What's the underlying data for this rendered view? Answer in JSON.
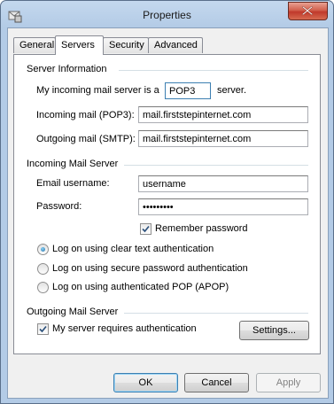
{
  "window": {
    "title": "Properties"
  },
  "tabs": [
    {
      "label": "General"
    },
    {
      "label": "Servers"
    },
    {
      "label": "Security"
    },
    {
      "label": "Advanced"
    }
  ],
  "server_info": {
    "group_title": "Server Information",
    "incoming_prefix": "My incoming mail server is a",
    "server_type_value": "POP3",
    "incoming_suffix": "server.",
    "incoming_label": "Incoming mail (POP3):",
    "incoming_value": "mail.firststepinternet.com",
    "outgoing_label": "Outgoing mail (SMTP):",
    "outgoing_value": "mail.firststepinternet.com"
  },
  "incoming_server": {
    "group_title": "Incoming Mail Server",
    "username_label": "Email username:",
    "username_value": "username",
    "password_label": "Password:",
    "password_value": "•••••••••",
    "remember_label": "Remember password",
    "remember_checked": true,
    "auth_options": [
      {
        "label": "Log on using clear text authentication",
        "selected": true
      },
      {
        "label": "Log on using secure password authentication",
        "selected": false
      },
      {
        "label": "Log on using authenticated POP (APOP)",
        "selected": false
      }
    ]
  },
  "outgoing_server": {
    "group_title": "Outgoing Mail Server",
    "requires_auth_label": "My server requires authentication",
    "requires_auth_checked": true,
    "settings_label": "Settings..."
  },
  "footer": {
    "ok_label": "OK",
    "cancel_label": "Cancel",
    "apply_label": "Apply"
  }
}
